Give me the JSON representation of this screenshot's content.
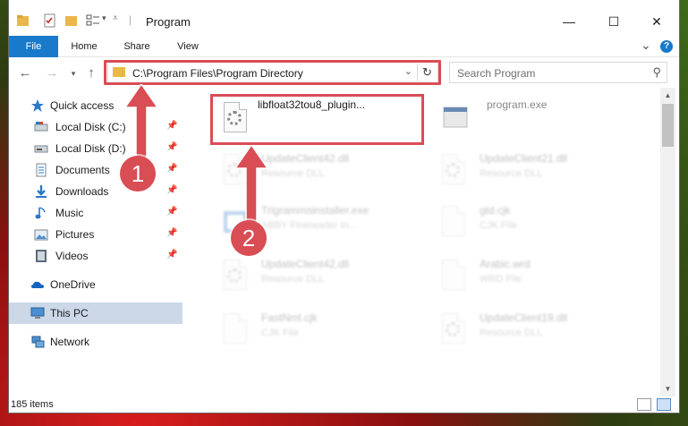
{
  "window": {
    "title": "Program",
    "controls": {
      "minimize": "—",
      "maximize": "☐",
      "close": "✕"
    }
  },
  "ribbon": {
    "tabs": [
      "File",
      "Home",
      "Share",
      "View"
    ],
    "expand_glyph": "⌄",
    "help_glyph": "?"
  },
  "address": {
    "path": "C:\\Program Files\\Program Directory",
    "search_placeholder": "Search Program"
  },
  "nav": {
    "items": [
      {
        "label": "Quick access",
        "icon": "star-icon",
        "pinned": false
      },
      {
        "label": "Local Disk (C:)",
        "icon": "drive-icon",
        "pinned": true
      },
      {
        "label": "Local Disk (D:)",
        "icon": "drive-icon",
        "pinned": true
      },
      {
        "label": "Documents",
        "icon": "documents-icon",
        "pinned": true
      },
      {
        "label": "Downloads",
        "icon": "download-icon",
        "pinned": true
      },
      {
        "label": "Music",
        "icon": "music-icon",
        "pinned": true
      },
      {
        "label": "Pictures",
        "icon": "pictures-icon",
        "pinned": true
      },
      {
        "label": "Videos",
        "icon": "videos-icon",
        "pinned": true
      },
      {
        "label": "OneDrive",
        "icon": "cloud-icon",
        "pinned": false
      },
      {
        "label": "This PC",
        "icon": "computer-icon",
        "pinned": false
      },
      {
        "label": "Network",
        "icon": "network-icon",
        "pinned": false
      }
    ]
  },
  "files": [
    {
      "name": "libfloat32tou8_plugin...",
      "type": "",
      "highlighted": true
    },
    {
      "name": "program.exe",
      "type": ""
    },
    {
      "name": "UpdateClient42.dll",
      "type": "Resource DLL"
    },
    {
      "name": "UpdateClient21.dll",
      "type": "Resource DLL"
    },
    {
      "name": "Trigrammsinstaller.exe",
      "type": "ABBY Finereader In..."
    },
    {
      "name": "gtd.cjk",
      "type": "CJK File"
    },
    {
      "name": "UpdateClient42.dll",
      "type": "Resource DLL"
    },
    {
      "name": "Arabic.wrd",
      "type": "WRD File"
    },
    {
      "name": "FastNml.cjk",
      "type": "CJK File"
    },
    {
      "name": "UpdateClient19.dll",
      "type": "Resource DLL"
    }
  ],
  "status": {
    "item_count": "185 items"
  },
  "annotations": {
    "step1": "1",
    "step2": "2"
  },
  "colors": {
    "accent": "#1979ca",
    "highlight": "#d94d55",
    "selected": "#ccd8e8"
  }
}
